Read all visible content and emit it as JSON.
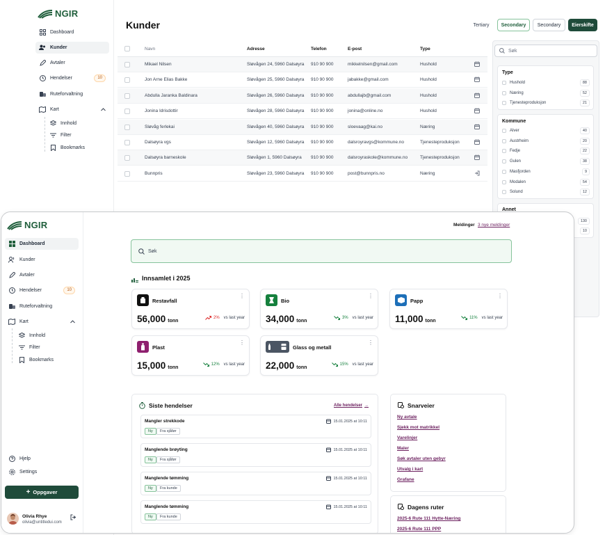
{
  "brand": {
    "name": "NGIR",
    "color": "#1f5e3b"
  },
  "back": {
    "nav": [
      {
        "label": "Dashboard",
        "icon": "grid-icon"
      },
      {
        "label": "Kunder",
        "icon": "users-icon"
      },
      {
        "label": "Avtaler",
        "icon": "pen-icon"
      },
      {
        "label": "Hendelser",
        "icon": "clock-icon",
        "badge": "10"
      },
      {
        "label": "Ruteforvaltning",
        "icon": "route-icon"
      },
      {
        "label": "Kart",
        "icon": "map-icon"
      }
    ],
    "kart_sub": [
      "Innhold",
      "Filter",
      "Bookmarks"
    ],
    "title": "Kunder",
    "buttons": {
      "tertiary": "Tertiary",
      "secondary_green": "Secondary",
      "secondary": "Secondary",
      "primary": "Eierskifte"
    },
    "table": {
      "headers": [
        "Navn",
        "Adresse",
        "Telefon",
        "E-post",
        "Type"
      ],
      "rows": [
        [
          "Mikael Nilsen",
          "Sløvågen 24, 5960 Dalsøyra",
          "910 90 900",
          "mikkelnilsen@gmail.com",
          "Hushold"
        ],
        [
          "Jon Arne Elias Bakke",
          "Sløvågen 25, 5960 Dalsøyra",
          "910 90 900",
          "jabakke@gmail.com",
          "Hushold"
        ],
        [
          "Abdulla Jaranka Baldinara",
          "Sløvågen 26, 5960 Dalsøyra",
          "910 90 900",
          "abdullajb@gmail.com",
          "Hushold"
        ],
        [
          "Jonina Idrisdottir",
          "Sløvågen 28, 5960 Dalsøyra",
          "910 90 900",
          "jonina@online.no",
          "Hushold"
        ],
        [
          "Sløvåg ferlekai",
          "Sløvågen 40, 5960 Dalsøyra",
          "910 90 900",
          "sloevaag@kai.no",
          "Næring"
        ],
        [
          "Dalsøyra vgs",
          "Sløvågen 12, 5960 Dalsøyra",
          "910 90 900",
          "dalsroyravgs@kommune.no",
          "Tjenesteproduksjon"
        ],
        [
          "Dalsøyra barneskole",
          "Sløvågen 1, 5960 Dalsøyra",
          "910 90 900",
          "dalsroyraskole@kommune.no",
          "Tjenesteproduksjon"
        ],
        [
          "Bunnpris",
          "Sløvågen 23, 5960 Dalsøyra",
          "910 90 900",
          "post@bunnpris.no",
          "Næring"
        ]
      ]
    },
    "filter": {
      "search_placeholder": "Søk",
      "type": {
        "title": "Type",
        "items": [
          {
            "label": "Hushold",
            "count": "88"
          },
          {
            "label": "Næring",
            "count": "52"
          },
          {
            "label": "Tjenesteproduksjon",
            "count": "21"
          }
        ]
      },
      "kommune": {
        "title": "Kommune",
        "items": [
          {
            "label": "Alver",
            "count": "40"
          },
          {
            "label": "Austrheim",
            "count": "20"
          },
          {
            "label": "Fedje",
            "count": "22"
          },
          {
            "label": "Gulen",
            "count": "38"
          },
          {
            "label": "Masfjorden",
            "count": "9"
          },
          {
            "label": "Modalen",
            "count": "54"
          },
          {
            "label": "Solund",
            "count": "12"
          }
        ]
      },
      "annet": {
        "title": "Annet",
        "counts": [
          "130",
          "10"
        ]
      }
    }
  },
  "front": {
    "nav": [
      {
        "label": "Dashboard",
        "icon": "grid-icon"
      },
      {
        "label": "Kunder",
        "icon": "users-icon"
      },
      {
        "label": "Avtaler",
        "icon": "pen-icon"
      },
      {
        "label": "Hendelser",
        "icon": "clock-icon",
        "badge": "10"
      },
      {
        "label": "Ruteforvaltning",
        "icon": "route-icon"
      },
      {
        "label": "Kart",
        "icon": "map-icon"
      }
    ],
    "kart_sub": [
      "Innhold",
      "Filter",
      "Bookmarks"
    ],
    "help": "Hjelp",
    "settings": "Settings",
    "new_task": "Oppgaver",
    "user": {
      "name": "Olivia Rhye",
      "email": "olivia@untitledui.com"
    },
    "messages": {
      "label": "Meldinger",
      "link": "3 nye meldinger"
    },
    "search_placeholder": "Søk",
    "collected": {
      "title": "Innsamlet i 2025",
      "cards": [
        {
          "name": "Restavfall",
          "value": "56,000",
          "unit": "tonn",
          "trend": "2%",
          "trend_dir": "up",
          "vs": "vs last year",
          "color": "#111111"
        },
        {
          "name": "Bio",
          "value": "34,000",
          "unit": "tonn",
          "trend": "3%",
          "trend_dir": "down",
          "vs": "vs last year",
          "color": "#15803d"
        },
        {
          "name": "Papp",
          "value": "11,000",
          "unit": "tonn",
          "trend": "11%",
          "trend_dir": "down",
          "vs": "vs last year",
          "color": "#1d6fb8"
        },
        {
          "name": "Plast",
          "value": "15,000",
          "unit": "tonn",
          "trend": "12%",
          "trend_dir": "down",
          "vs": "vs last year",
          "color": "#8e1f6e"
        },
        {
          "name": "Glass og metall",
          "value": "22,000",
          "unit": "tonn",
          "trend": "15%",
          "trend_dir": "down",
          "vs": "vs last year",
          "color": "#4b5563"
        }
      ]
    },
    "events": {
      "title": "Siste hendelser",
      "all": "Alle hendelser",
      "items": [
        {
          "title": "Mangler strekkode",
          "date": "15.01.2025 at 10:11",
          "tags": [
            "Ny",
            "Fra sjåfør"
          ]
        },
        {
          "title": "Manglende brøyting",
          "date": "15.01.2025 at 10:11",
          "tags": [
            "Ny",
            "Fra sjåfør"
          ]
        },
        {
          "title": "Manglende tømming",
          "date": "15.01.2025 at 10:11",
          "tags": [
            "Ny",
            "Fra kunde"
          ]
        },
        {
          "title": "Manglende tømming",
          "date": "15.01.2025 at 10:11",
          "tags": [
            "Ny",
            "Fra kunde"
          ]
        }
      ]
    },
    "shortcuts": {
      "title": "Snarveier",
      "links": [
        "Ny avtale",
        "Sjekk mot matrikkel",
        "Varelinjer",
        "Maler",
        "Søk avtaler uten gebyr",
        "Utvalg i kart",
        "Grafane"
      ]
    },
    "routes": {
      "title": "Dagens ruter",
      "links": [
        "2025-6 Rute 111 Hytte-Næring",
        "2025-6 Rute 111 PPP"
      ]
    }
  }
}
